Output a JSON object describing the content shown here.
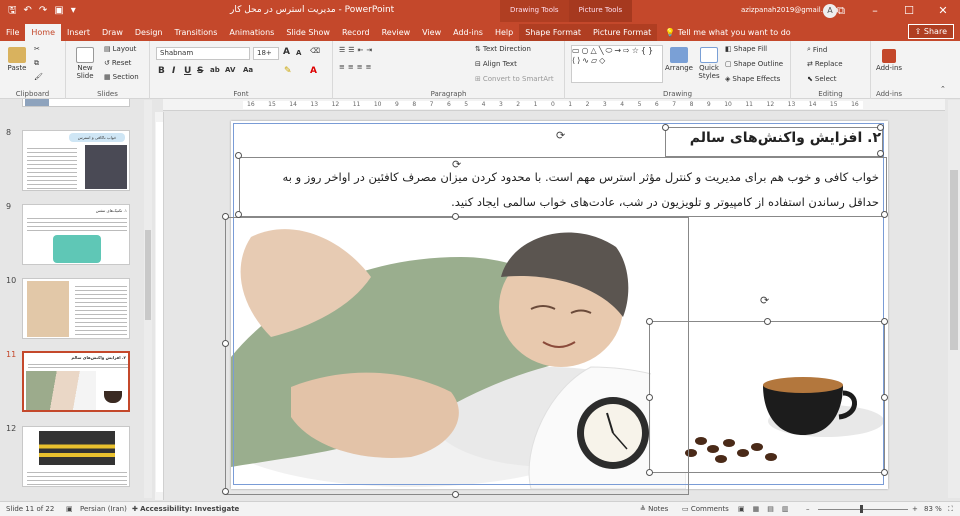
{
  "titlebar": {
    "title": "مدیریت استرس در محل کار  -  PowerPoint",
    "contextual_tab_1": "Drawing Tools",
    "contextual_tab_2": "Picture Tools",
    "account": "azizpanah2019@gmail.com",
    "avatar_letter": "A",
    "minimize": "–",
    "maximize": "☐",
    "close": "✕"
  },
  "tabs": [
    "File",
    "Home",
    "Insert",
    "Draw",
    "Design",
    "Transitions",
    "Animations",
    "Slide Show",
    "Record",
    "Review",
    "View",
    "Add-ins",
    "Help",
    "Shape Format",
    "Picture Format"
  ],
  "active_tab": "Home",
  "tell_me": "Tell me what you want to do",
  "share": "Share",
  "ribbon": {
    "clipboard": {
      "label": "Clipboard",
      "paste": "Paste"
    },
    "slides": {
      "label": "Slides",
      "new_slide": "New Slide",
      "layout": "Layout",
      "reset": "Reset",
      "section": "Section"
    },
    "font": {
      "label": "Font",
      "font_name": "Shabnam",
      "font_size": "18+",
      "grow": "A",
      "shrink": "A",
      "bold": "B",
      "italic": "I",
      "underline": "U",
      "strike": "S",
      "shadow": "ab",
      "spacing": "AV",
      "case": "Aa"
    },
    "paragraph": {
      "label": "Paragraph",
      "text_direction": "Text Direction",
      "align_text": "Align Text",
      "smartart": "Convert to SmartArt"
    },
    "drawing": {
      "label": "Drawing",
      "arrange": "Arrange",
      "quick_styles": "Quick Styles",
      "shape_fill": "Shape Fill",
      "shape_outline": "Shape Outline",
      "shape_effects": "Shape Effects"
    },
    "editing": {
      "label": "Editing",
      "find": "Find",
      "replace": "Replace",
      "select": "Select"
    },
    "addins": {
      "label": "Add-ins",
      "addins": "Add-ins"
    }
  },
  "ruler_numbers": [
    "16",
    "15",
    "14",
    "13",
    "12",
    "11",
    "10",
    "9",
    "8",
    "7",
    "6",
    "5",
    "4",
    "3",
    "2",
    "1",
    "0",
    "1",
    "2",
    "3",
    "4",
    "5",
    "6",
    "7",
    "8",
    "9",
    "10",
    "11",
    "12",
    "13",
    "14",
    "15",
    "16"
  ],
  "thumbnails": [
    {
      "num": "8",
      "title": "خواب ناکافی و استرس"
    },
    {
      "num": "9",
      "title": "۱. تکنیک‌های تنفس"
    },
    {
      "num": "10",
      "title": ""
    },
    {
      "num": "11",
      "title": "۲. افزایش واکنش‌های سالم"
    },
    {
      "num": "12",
      "title": ""
    }
  ],
  "selected_slide": "11",
  "slide": {
    "heading": "۲. افزایش واکنش‌های سالم",
    "body_line1": "خواب کافی و خوب هم برای مدیریت و کنترل مؤثر استرس مهم است. با محدود کردن میزان مصرف کافئین در اواخر روز و به",
    "body_line2": "حداقل رساندن استفاده از کامپیوتر و تلویزیون در شب، عادت‌های خواب سالمی ایجاد کنید."
  },
  "status": {
    "slide_info": "Slide 11 of 22",
    "language": "Persian (Iran)",
    "accessibility": "Accessibility: Investigate",
    "notes": "Notes",
    "comments": "Comments",
    "zoom": "83 %"
  }
}
